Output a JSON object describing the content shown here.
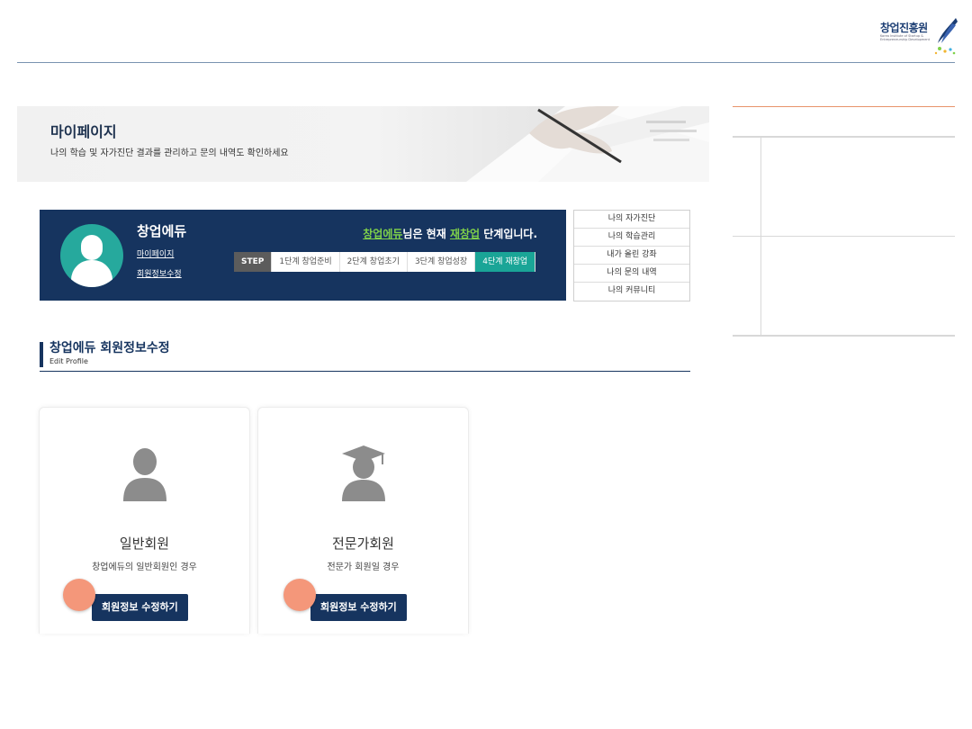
{
  "header": {
    "logo_text": "창업진흥원",
    "logo_sub": "Korea Institute of Startup & Entrepreneurship Development"
  },
  "banner": {
    "title": "마이페이지",
    "subtitle": "나의 학습 및 자가진단 결과를 관리하고 문의 내역도 확인하세요"
  },
  "profile": {
    "name": "창업에듀",
    "links": [
      "마이페이지",
      "회원정보수정"
    ],
    "status_prefix": "창업에듀",
    "status_mid": "님은 현재 ",
    "status_stage": "재창업",
    "status_suffix": " 단계입니다.",
    "step_label": "STEP",
    "steps": [
      "1단계 창업준비",
      "2단계 창업초기",
      "3단계 창업성장",
      "4단계 재창업"
    ]
  },
  "quick_menu": [
    "나의 자가진단",
    "나의 학습관리",
    "내가 올린 강좌",
    "나의 문의 내역",
    "나의 커뮤니티"
  ],
  "section": {
    "title": "창업에듀 회원정보수정",
    "subtitle": "Edit Profile"
  },
  "cards": [
    {
      "title": "일반회원",
      "desc": "창업에듀의 일반회원인 경우",
      "button": "회원정보 수정하기",
      "icon": "person-icon"
    },
    {
      "title": "전문가회원",
      "desc": "전문가 회원일 경우",
      "button": "회원정보 수정하기",
      "icon": "graduate-icon"
    }
  ],
  "colors": {
    "navy": "#16345f",
    "teal": "#1aa597",
    "accent_dot": "#f4977a",
    "highlight": "#7fd14a"
  }
}
